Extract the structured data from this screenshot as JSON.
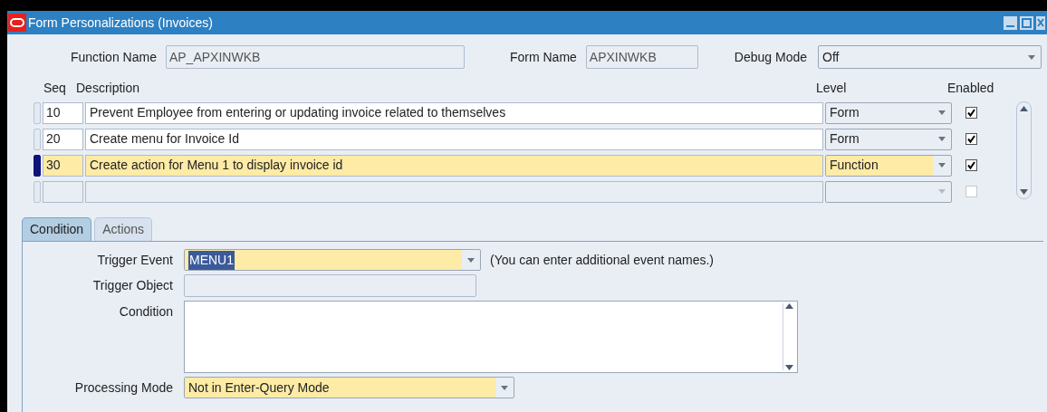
{
  "window": {
    "title": "Form Personalizations (Invoices)"
  },
  "header": {
    "function_name": {
      "label": "Function Name",
      "value": "AP_APXINWKB"
    },
    "form_name": {
      "label": "Form Name",
      "value": "APXINWKB"
    },
    "debug_mode": {
      "label": "Debug Mode",
      "value": "Off"
    }
  },
  "table": {
    "columns": [
      "Seq",
      "Description",
      "Level",
      "Enabled"
    ],
    "rows": [
      {
        "seq": "10",
        "description": "Prevent Employee from entering or updating invoice related to themselves",
        "level": "Form",
        "enabled": true,
        "selected": false
      },
      {
        "seq": "20",
        "description": "Create menu for Invoice Id",
        "level": "Form",
        "enabled": true,
        "selected": false
      },
      {
        "seq": "30",
        "description": "Create action for Menu 1 to display invoice id",
        "level": "Function",
        "enabled": true,
        "selected": true
      },
      {
        "enabled": false,
        "selected": false
      }
    ]
  },
  "tabs": [
    {
      "label": "Condition",
      "selected": true
    },
    {
      "label": "Actions",
      "selected": false
    }
  ],
  "condition": {
    "trigger_event": {
      "label": "Trigger Event",
      "value": "MENU1",
      "note": "(You can enter additional event names.)"
    },
    "trigger_object": {
      "label": "Trigger Object"
    },
    "condition": {
      "label": "Condition"
    },
    "processing_mode": {
      "label": "Processing Mode",
      "value": "Not in Enter-Query Mode"
    }
  }
}
